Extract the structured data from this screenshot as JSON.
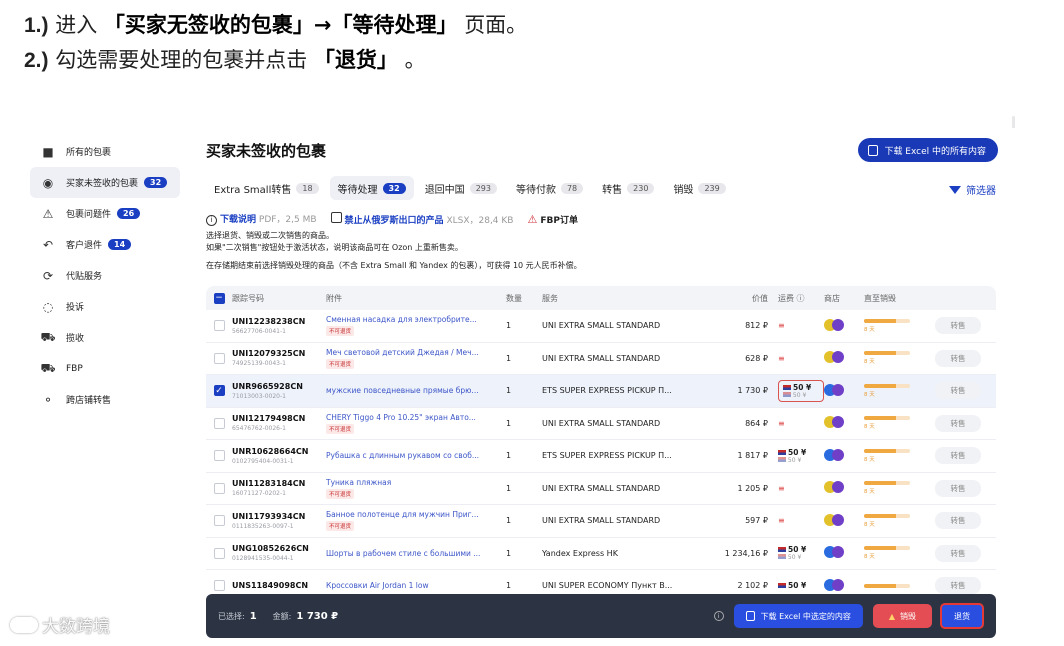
{
  "instructions": {
    "line1": {
      "num": "1.)",
      "pre": "进入",
      "tab_a": "「买家无签收的包裹」→「等待处理」",
      "post": "页面。"
    },
    "line2": {
      "num": "2.)",
      "pre": "勾选需要处理的包裹并点击",
      "button": "「退货」",
      "post": "。"
    }
  },
  "sidebar": {
    "items": [
      {
        "label": "所有的包裹",
        "icon": "box-icon"
      },
      {
        "label": "买家未签收的包裹",
        "icon": "eye-off-icon",
        "badge": "32",
        "active": true
      },
      {
        "label": "包裹问题件",
        "icon": "warning-icon",
        "badge": "26"
      },
      {
        "label": "客户退件",
        "icon": "return-icon",
        "badge": "14"
      },
      {
        "label": "代贴服务",
        "icon": "sync-icon"
      },
      {
        "label": "投诉",
        "icon": "chat-icon"
      },
      {
        "label": "揽收",
        "icon": "truck-icon"
      },
      {
        "label": "FBP",
        "icon": "truck-icon"
      },
      {
        "label": "跨店铺转售",
        "icon": "share-icon"
      }
    ]
  },
  "header": {
    "title": "买家未签收的包裹",
    "export_all": "下载 Excel 中的所有内容",
    "filter": "筛选器"
  },
  "tabs": [
    {
      "label": "Extra Small转售",
      "count": "18"
    },
    {
      "label": "等待处理",
      "count": "32",
      "active": true
    },
    {
      "label": "退回中国",
      "count": "293"
    },
    {
      "label": "等待付款",
      "count": "78"
    },
    {
      "label": "转售",
      "count": "230"
    },
    {
      "label": "销毁",
      "count": "239"
    }
  ],
  "info": {
    "download": "下载说明",
    "download_meta": "PDF，2,5 MB",
    "banned": "禁止从俄罗斯出口的产品",
    "banned_meta": "XLSX，28,4 KB",
    "fbp": "FBP订单",
    "line1": "选择退货、销毁或二次销售的商品。",
    "line2": "如果\"二次销售\"按钮处于激活状态，说明该商品可在 Ozon 上重新售卖。",
    "line3": "在存储期结束前选择销毁处理的商品（不含 Extra Small 和 Yandex 的包裹），可获得 10 元人民币补偿。"
  },
  "table": {
    "headers": {
      "track": "跟踪号码",
      "item": "附件",
      "qty": "数量",
      "service": "服务",
      "price": "价值",
      "ship": "运费",
      "store": "商店",
      "expiry": "直至销毁"
    },
    "rows": [
      {
        "track": "UNI12238238CN",
        "sub": "56627706-0041-1",
        "item": "Сменная насадка для электробрите...",
        "tag": "不可退货",
        "qty": "1",
        "service": "UNI EXTRA SMALL STANDARD",
        "price": "812 ₽",
        "ship": "",
        "ship_sub": "",
        "store_color": "#e3c12a",
        "exp_pct": 0.7,
        "exp_txt": "8 天",
        "sell": "转售"
      },
      {
        "track": "UNI12079325CN",
        "sub": "74925139-0043-1",
        "item": "Меч световой детский Джедая / Меч...",
        "tag": "不可退货",
        "qty": "1",
        "service": "UNI EXTRA SMALL STANDARD",
        "price": "628 ₽",
        "ship": "",
        "ship_sub": "",
        "store_color": "#e3c12a",
        "exp_pct": 0.7,
        "exp_txt": "8 天",
        "sell": "转售"
      },
      {
        "track": "UNR9665928CN",
        "sub": "71013003-0020-1",
        "item": "мужские повседневные прямые брю...",
        "tag": "",
        "qty": "1",
        "service": "ETS SUPER EXPRESS PICKUP П...",
        "price": "1 730 ₽",
        "ship": "50 ¥",
        "ship_sub": "50 ¥",
        "store_color": "#2a6ce0",
        "exp_pct": 0.7,
        "exp_txt": "8 天",
        "sell": "转售",
        "selected": true,
        "boxed": true
      },
      {
        "track": "UNI12179498CN",
        "sub": "65476762-0026-1",
        "item": "CHERY Tiggo 4 Pro 10.25\" экран Авто...",
        "tag": "不可退货",
        "qty": "1",
        "service": "UNI EXTRA SMALL STANDARD",
        "price": "864 ₽",
        "ship": "",
        "ship_sub": "",
        "store_color": "#e3c12a",
        "exp_pct": 0.7,
        "exp_txt": "8 天",
        "sell": "转售"
      },
      {
        "track": "UNR10628664CN",
        "sub": "0102795404-0031-1",
        "item": "Рубашка с длинным рукавом со своб...",
        "tag": "",
        "qty": "1",
        "service": "ETS SUPER EXPRESS PICKUP П...",
        "price": "1 817 ₽",
        "ship": "50 ¥",
        "ship_sub": "50 ¥",
        "store_color": "#2a6ce0",
        "exp_pct": 0.7,
        "exp_txt": "8 天",
        "sell": "转售"
      },
      {
        "track": "UNI11283184CN",
        "sub": "16071127-0202-1",
        "item": "Туника пляжная",
        "tag": "不可退货",
        "qty": "1",
        "service": "UNI EXTRA SMALL STANDARD",
        "price": "1 205 ₽",
        "ship": "",
        "ship_sub": "",
        "store_color": "#e3c12a",
        "exp_pct": 0.7,
        "exp_txt": "8 天",
        "sell": "转售"
      },
      {
        "track": "UNI11793934CN",
        "sub": "0111835263-0097-1",
        "item": "Банное полотенце для мужчин Приг...",
        "tag": "不可退货",
        "qty": "1",
        "service": "UNI EXTRA SMALL STANDARD",
        "price": "597 ₽",
        "ship": "",
        "ship_sub": "",
        "store_color": "#e3c12a",
        "exp_pct": 0.7,
        "exp_txt": "8 天",
        "sell": "转售"
      },
      {
        "track": "UNG10852626CN",
        "sub": "0128941535-0044-1",
        "item": "Шорты в рабочем стиле с большими ...",
        "tag": "",
        "qty": "1",
        "service": "Yandex Express HK",
        "price": "1 234,16 ₽",
        "ship": "50 ¥",
        "ship_sub": "50 ¥",
        "store_color": "#2a6ce0",
        "exp_pct": 0.7,
        "exp_txt": "8 天",
        "sell": "转售"
      },
      {
        "track": "UNS11849098CN",
        "sub": "",
        "item": "Кроссовки Air Jordan 1 low",
        "tag": "",
        "qty": "1",
        "service": "UNI SUPER ECONOMY Пункт В...",
        "price": "2 102 ₽",
        "ship": "50 ¥",
        "ship_sub": "",
        "store_color": "#2a6ce0",
        "exp_pct": 0.7,
        "exp_txt": "",
        "sell": "转售"
      }
    ]
  },
  "bottom_bar": {
    "selected_label": "已选择:",
    "selected_count": "1",
    "total_label": "金额:",
    "total_value": "1 730 ₽",
    "export_selected": "下载 Excel 中选定的内容",
    "destroy": "销毁",
    "return": "退货"
  },
  "watermark": "大数跨境"
}
